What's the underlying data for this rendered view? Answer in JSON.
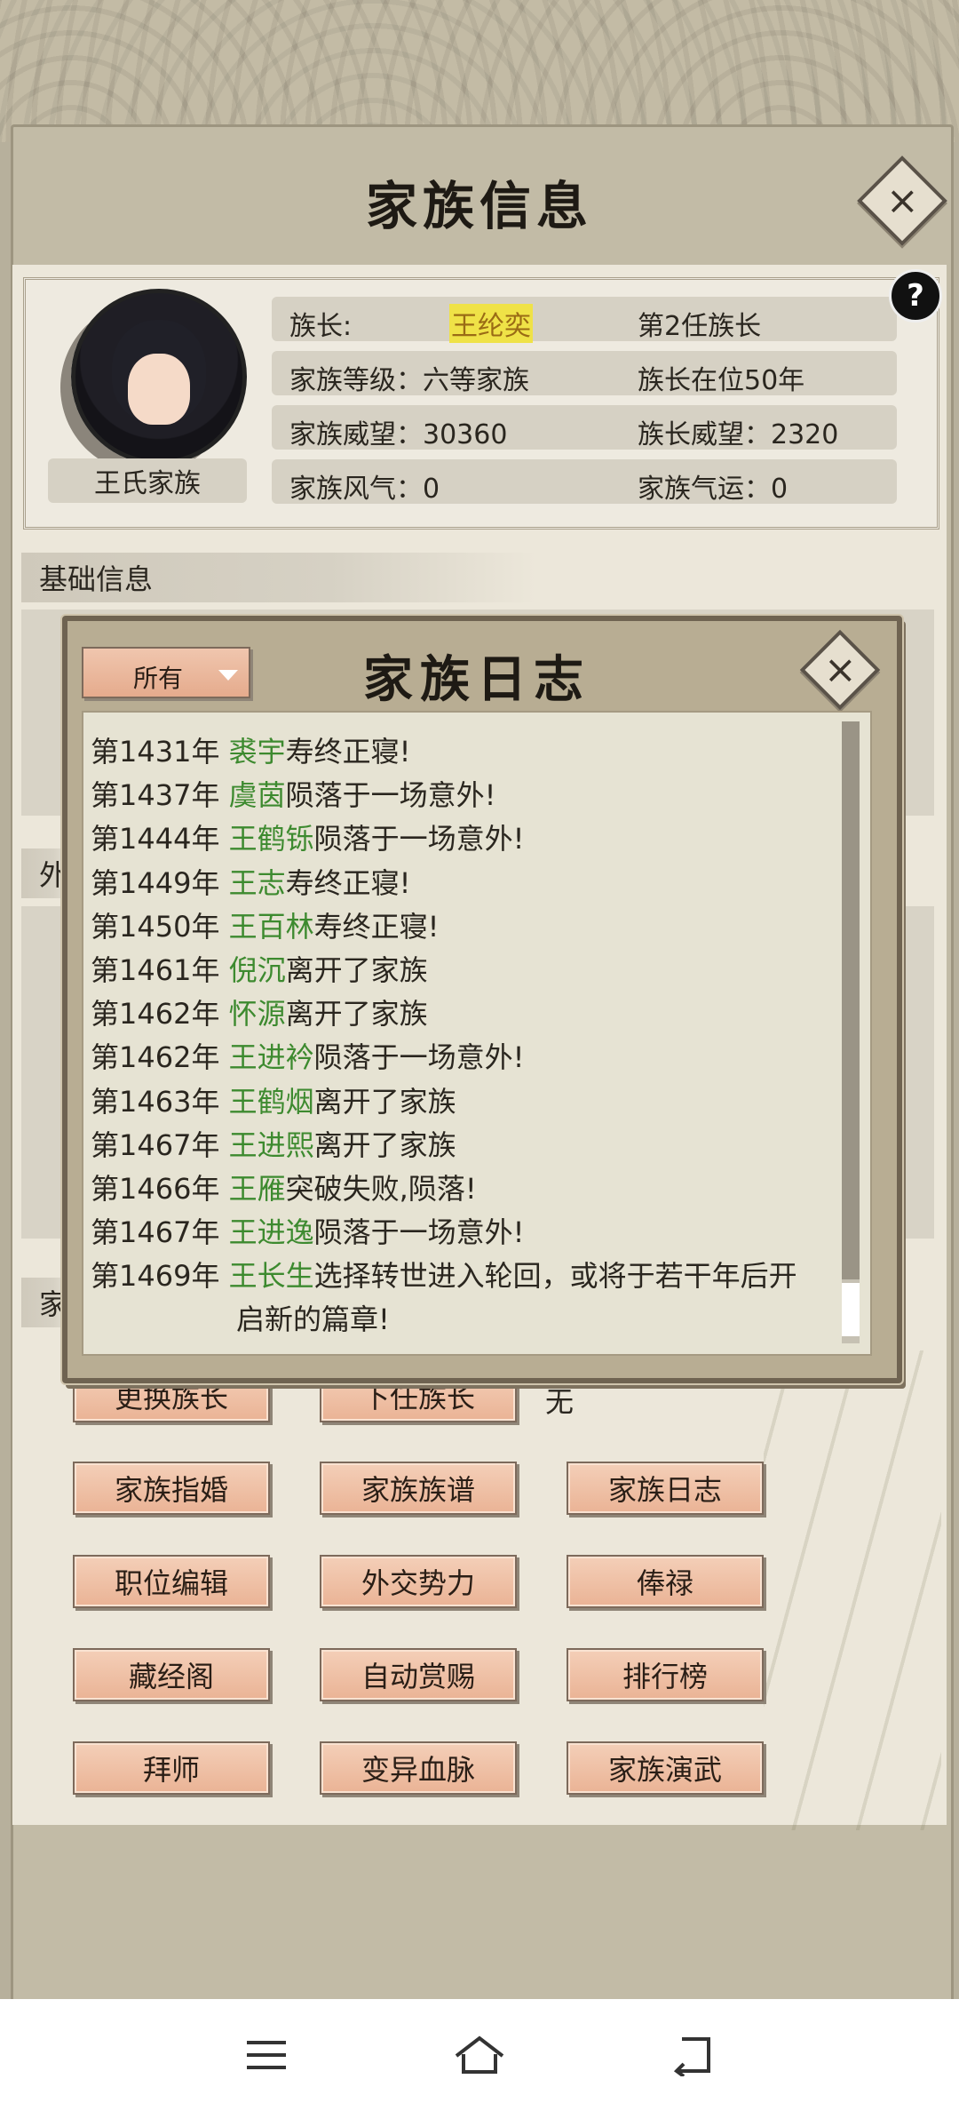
{
  "header": {
    "title": "家族信息"
  },
  "info": {
    "family_name": "王氏家族",
    "rows": [
      {
        "left": "族长:",
        "leader": "王纶奕",
        "right": "第2任族长"
      },
      {
        "left": "家族等级：六等家族",
        "right": "族长在位50年"
      },
      {
        "left": "家族威望：30360",
        "right": "族长威望：2320"
      },
      {
        "left": "家族风气：0",
        "right": "家族气运：0"
      }
    ],
    "help_label": "?"
  },
  "sections": {
    "basic": "基础信息",
    "partial_wai": "外",
    "partial_jia": "家"
  },
  "modal": {
    "title": "家族日志",
    "filter": "所有",
    "logs": [
      {
        "year": "第1431年 ",
        "name": "裘宇",
        "event": "寿终正寝!"
      },
      {
        "year": "第1437年 ",
        "name": "虞茵",
        "event": "陨落于一场意外!"
      },
      {
        "year": "第1444年 ",
        "name": "王鹤铄",
        "event": "陨落于一场意外!"
      },
      {
        "year": "第1449年 ",
        "name": "王志",
        "event": "寿终正寝!"
      },
      {
        "year": "第1450年 ",
        "name": "王百林",
        "event": "寿终正寝!"
      },
      {
        "year": "第1461年 ",
        "name": "倪沉",
        "event": "离开了家族"
      },
      {
        "year": "第1462年 ",
        "name": "怀源",
        "event": "离开了家族"
      },
      {
        "year": "第1462年 ",
        "name": "王进衿",
        "event": "陨落于一场意外!"
      },
      {
        "year": "第1463年 ",
        "name": "王鹤烟",
        "event": "离开了家族"
      },
      {
        "year": "第1467年 ",
        "name": "王进熙",
        "event": "离开了家族"
      },
      {
        "year": "第1466年 ",
        "name": "王雁",
        "event": "突破失败,陨落!"
      },
      {
        "year": "第1467年 ",
        "name": "王进逸",
        "event": "陨落于一场意外!"
      }
    ],
    "last_log": {
      "year": "第1469年 ",
      "name": "王长生",
      "event": "选择转世进入轮回，或将于若干年后开",
      "cont": "启新的篇章!"
    }
  },
  "actions": {
    "change_leader": "更换族长",
    "next_leader": "下任族长",
    "next_leader_value": "无",
    "grid": [
      [
        "家族指婚",
        "家族族谱",
        "家族日志"
      ],
      [
        "职位编辑",
        "外交势力",
        "俸禄"
      ],
      [
        "藏经阁",
        "自动赏赐",
        "排行榜"
      ],
      [
        "拜师",
        "变异血脉",
        "家族演武"
      ]
    ]
  },
  "icons": {
    "close": "close-icon",
    "menu": "menu-icon",
    "home": "home-icon",
    "back": "back-icon"
  },
  "colors": {
    "name_green": "#3d8a2f",
    "leader_highlight": "#efe247",
    "button_peach": "#eab395"
  }
}
